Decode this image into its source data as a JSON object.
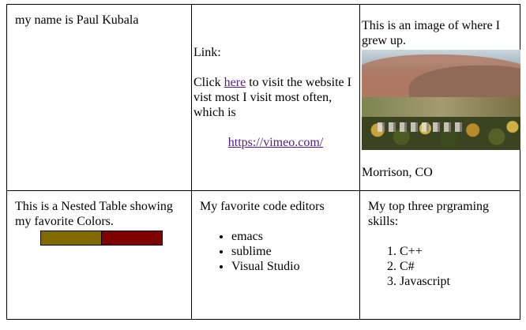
{
  "cell_name": {
    "text": "my name is Paul Kubala"
  },
  "cell_link": {
    "heading": "Link:",
    "click_prefix": "Click ",
    "link_text": "here",
    "click_suffix": " to visit the website I vist most I visit most often, which is",
    "url_text": "https://vimeo.com/"
  },
  "cell_image": {
    "caption": "This is an image of where I grew up.",
    "location": "Morrison, CO"
  },
  "cell_nested": {
    "text": "This is a Nested Table showing my favorite Colors.",
    "colors": [
      "#7f6b00",
      "#7f0000"
    ]
  },
  "cell_editors": {
    "title": "My favorite code editors",
    "items": [
      "emacs",
      "sublime",
      "Visual Studio"
    ]
  },
  "cell_skills": {
    "title": "My top three prgraming skills:",
    "items": [
      "C++",
      "C#",
      "Javascript"
    ]
  }
}
